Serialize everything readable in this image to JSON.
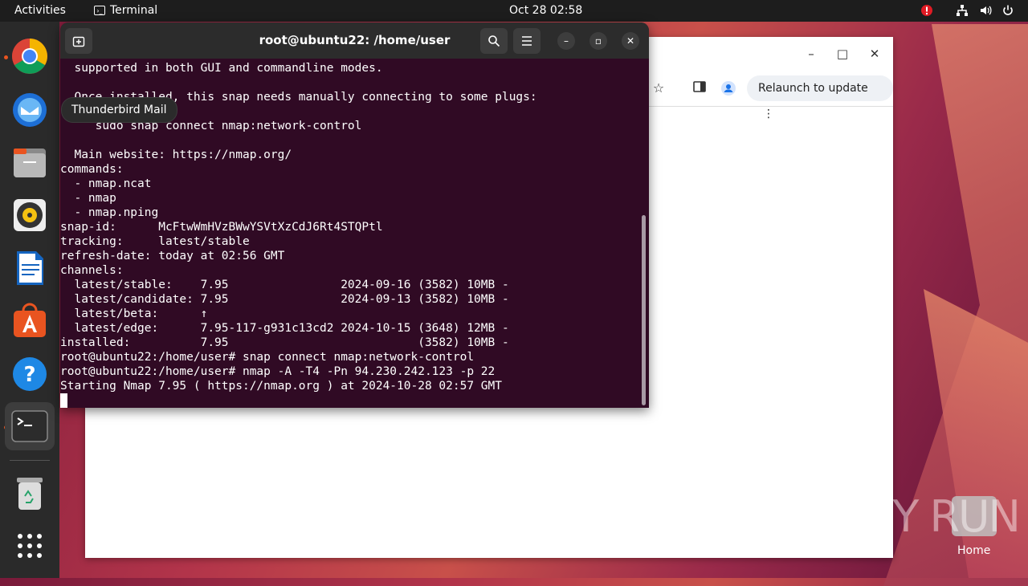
{
  "topbar": {
    "activities": "Activities",
    "app_name": "Terminal",
    "clock": "Oct 28  02:58"
  },
  "dock": {
    "tooltip": "Thunderbird Mail",
    "items": [
      "chrome",
      "thunderbird",
      "files",
      "rhythmbox",
      "writer",
      "software",
      "help",
      "terminal",
      "trash",
      "apps-grid"
    ]
  },
  "browser": {
    "relaunch": "Relaunch to update"
  },
  "terminal": {
    "title": "root@ubuntu22: /home/user",
    "lines": [
      "  supported in both GUI and commandline modes.",
      "",
      "  Once installed, this snap needs manually connecting to some plugs:",
      "",
      "     sudo snap connect nmap:network-control",
      "",
      "  Main website: https://nmap.org/",
      "commands:",
      "  - nmap.ncat",
      "  - nmap",
      "  - nmap.nping",
      "snap-id:      McFtwWmHVzBWwYSVtXzCdJ6Rt4STQPtl",
      "tracking:     latest/stable",
      "refresh-date: today at 02:56 GMT",
      "channels:",
      "  latest/stable:    7.95                2024-09-16 (3582) 10MB -",
      "  latest/candidate: 7.95                2024-09-13 (3582) 10MB -",
      "  latest/beta:      ↑",
      "  latest/edge:      7.95-117-g931c13cd2 2024-10-15 (3648) 12MB -",
      "installed:          7.95                           (3582) 10MB -",
      "root@ubuntu22:/home/user# snap connect nmap:network-control",
      "root@ubuntu22:/home/user# nmap -A -T4 -Pn 94.230.242.123 -p 22",
      "Starting Nmap 7.95 ( https://nmap.org ) at 2024-10-28 02:57 GMT"
    ]
  },
  "desktop": {
    "home_label": "Home",
    "watermark": "ANY RUN"
  }
}
